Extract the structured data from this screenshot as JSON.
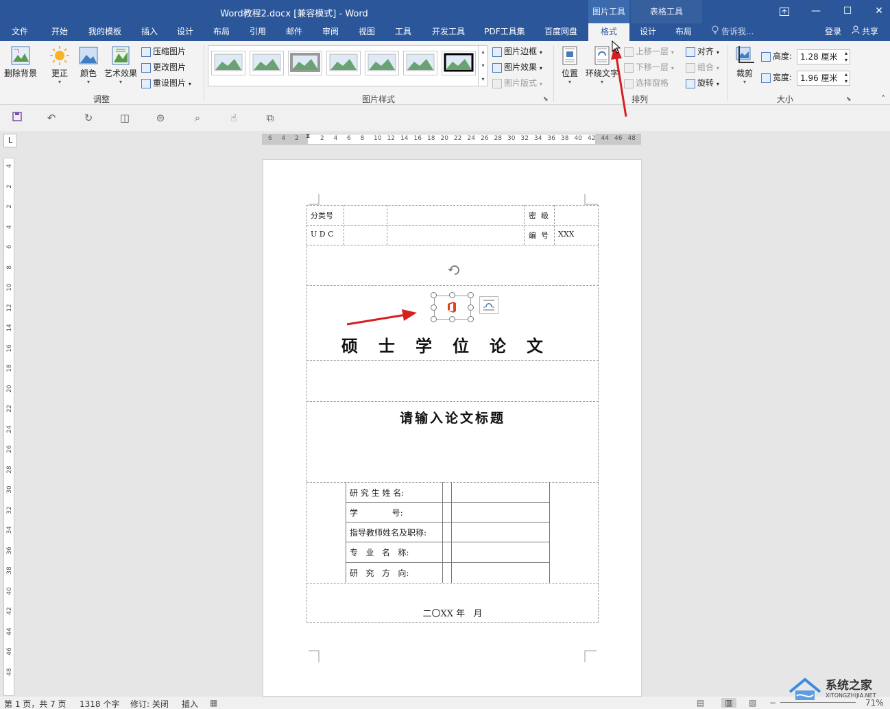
{
  "window": {
    "title": "Word教程2.docx [兼容模式] - Word",
    "context_picture_tools": "图片工具",
    "context_table_tools": "表格工具",
    "restore_icon": "restore-ribbon-icon",
    "minimize_glyph": "—",
    "maximize_glyph": "☐",
    "close_glyph": "✕"
  },
  "tabs": [
    {
      "label": "文件"
    },
    {
      "label": "开始"
    },
    {
      "label": "我的模板"
    },
    {
      "label": "插入"
    },
    {
      "label": "设计"
    },
    {
      "label": "布局"
    },
    {
      "label": "引用"
    },
    {
      "label": "邮件"
    },
    {
      "label": "审阅"
    },
    {
      "label": "视图"
    },
    {
      "label": "工具"
    },
    {
      "label": "开发工具"
    },
    {
      "label": "PDF工具集"
    },
    {
      "label": "百度网盘"
    },
    {
      "label": "格式",
      "selected": true
    },
    {
      "label": "设计"
    },
    {
      "label": "布局"
    }
  ],
  "tellme": "告诉我...",
  "login": "登录",
  "share": "共享",
  "ribbon": {
    "adjust": {
      "remove_bg": "删除背景",
      "corrections": "更正",
      "color": "颜色",
      "artistic": "艺术效果",
      "compress": "压缩图片",
      "change": "更改图片",
      "reset": "重设图片",
      "group_label": "调整"
    },
    "styles": {
      "border": "图片边框",
      "effects": "图片效果",
      "layout": "图片版式",
      "group_label": "图片样式"
    },
    "arrange": {
      "position": "位置",
      "wrap": "环绕文字",
      "bring_forward": "上移一层",
      "send_backward": "下移一层",
      "selection_pane": "选择窗格",
      "align": "对齐",
      "group": "组合",
      "rotate": "旋转",
      "group_label": "排列"
    },
    "size": {
      "crop": "裁剪",
      "height_label": "高度:",
      "height_value": "1.28 厘米",
      "width_label": "宽度:",
      "width_value": "1.96 厘米",
      "group_label": "大小"
    }
  },
  "ruler_h": [
    "6",
    "4",
    "2",
    "2",
    "4",
    "6",
    "8",
    "10",
    "12",
    "14",
    "16",
    "18",
    "20",
    "22",
    "24",
    "26",
    "28",
    "30",
    "32",
    "34",
    "36",
    "38",
    "40",
    "42",
    "44",
    "46",
    "48"
  ],
  "ruler_v": [
    "4",
    "2",
    "2",
    "4",
    "6",
    "8",
    "10",
    "12",
    "14",
    "16",
    "18",
    "20",
    "22",
    "24",
    "26",
    "28",
    "30",
    "32",
    "34",
    "36",
    "38",
    "40",
    "42",
    "44",
    "46",
    "48"
  ],
  "ruler_corner": "L",
  "doc": {
    "classification_label": "分类号",
    "security_label": "密  级",
    "udc_label": "U D C",
    "serial_label": "编  号",
    "serial_value": "XXX",
    "main_title": "硕士学位论文",
    "thesis_title_placeholder": "请输入论文标题",
    "info_rows": [
      {
        "label": "研 究 生 姓 名:"
      },
      {
        "label": "学             号:"
      },
      {
        "label": "指导教师姓名及职称:"
      },
      {
        "label": "专   业   名   称:"
      },
      {
        "label": "研   究   方   向:"
      }
    ],
    "date_line": "二〇XX 年   月"
  },
  "status": {
    "page": "第 1 页，共 7 页",
    "words": "1318 个字",
    "track": "修订: 关闭",
    "mode": "插入",
    "zoom": "71%"
  },
  "watermark": {
    "name": "系统之家",
    "url": "XITONGZHIJIA.NET"
  },
  "colors": {
    "titlebar": "#2b579a",
    "accent": "#2b579a",
    "arrow": "#d6201f"
  }
}
